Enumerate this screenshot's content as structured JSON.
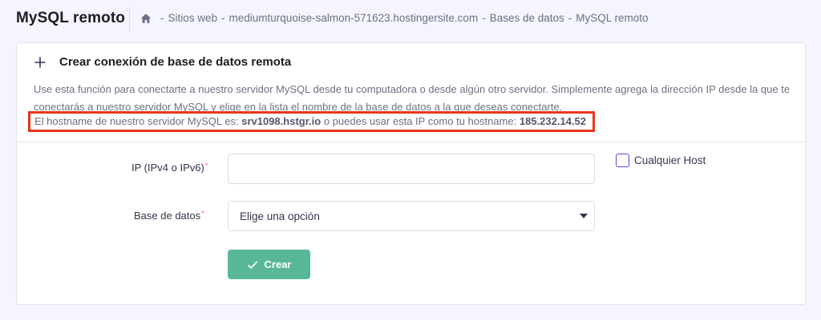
{
  "header": {
    "title": "MySQL remoto",
    "breadcrumb": {
      "home_icon": "home-icon",
      "sep": "-",
      "items": [
        "Sitios web",
        "mediumturquoise-salmon-571623.hostingersite.com",
        "Bases de datos",
        "MySQL remoto"
      ]
    }
  },
  "card": {
    "title": "Crear conexión de base de datos remota",
    "description": "Use esta función para conectarte a nuestro servidor MySQL desde tu computadora o desde algún otro servidor. Simplemente agrega la dirección IP desde la que te conectarás a nuestro servidor MySQL y elige en la lista el nombre de la base de datos a la que deseas conectarte.",
    "hostname": {
      "prefix": "El hostname de nuestro servidor MySQL es:",
      "server": "srv1098.hstgr.io",
      "middle": "o puedes usar esta IP como tu hostname:",
      "ip": "185.232.14.52"
    },
    "highlight_color": "#e6371d"
  },
  "form": {
    "ip_label": "IP (IPv4 o IPv6)",
    "ip_value": "",
    "required_mark": "*",
    "any_host_label": "Cualquier Host",
    "any_host_checked": false,
    "db_label": "Base de datos",
    "db_selected": "Elige una opción",
    "create_label": "Crear",
    "create_color": "#58b896"
  }
}
